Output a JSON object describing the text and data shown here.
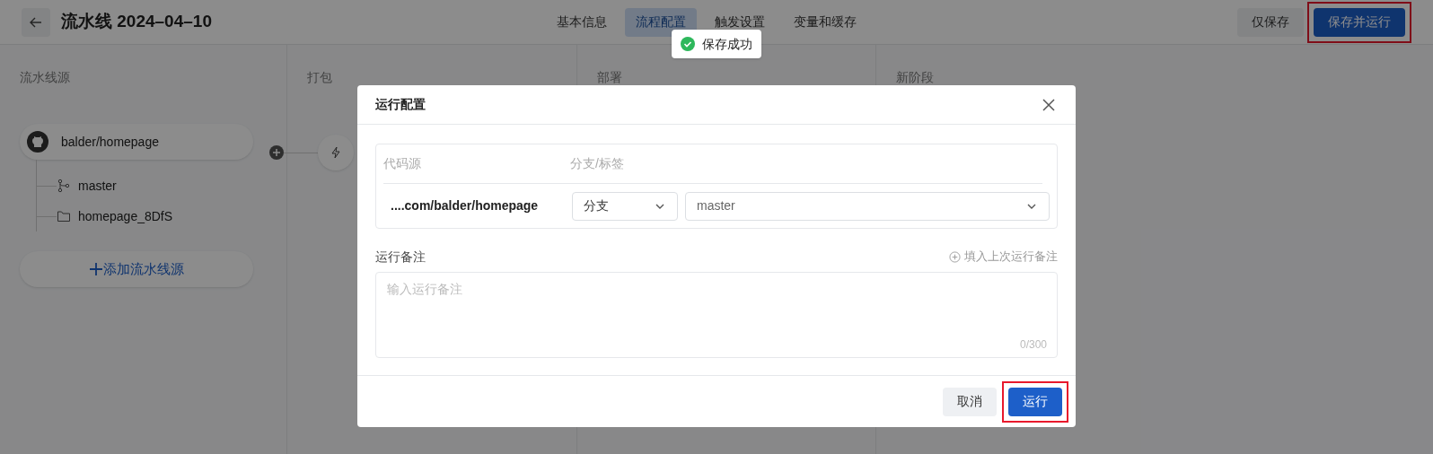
{
  "header": {
    "title": "流水线 2024–04–10",
    "tabs": [
      {
        "label": "基本信息",
        "selected": false
      },
      {
        "label": "流程配置",
        "selected": true
      },
      {
        "label": "触发设置",
        "selected": false
      },
      {
        "label": "变量和缓存",
        "selected": false
      }
    ],
    "actions": [
      {
        "label": "仅保存",
        "kind": "secondary",
        "highlighted": false
      },
      {
        "label": "保存并运行",
        "kind": "primary",
        "highlighted": true
      }
    ]
  },
  "toast": {
    "text": "保存成功"
  },
  "stages": [
    {
      "title": "流水线源"
    },
    {
      "title": "打包"
    },
    {
      "title": "部署"
    },
    {
      "title": "新阶段"
    }
  ],
  "source": {
    "repo": "balder/homepage",
    "children": [
      {
        "kind": "branch",
        "label": "master"
      },
      {
        "kind": "folder",
        "label": "homepage_8DfS"
      }
    ],
    "add_label": "添加流水线源"
  },
  "dialog": {
    "title": "运行配置",
    "columns": [
      "代码源",
      "分支/标签"
    ],
    "row": {
      "source": "....com/balder/homepage",
      "ref_type": "分支",
      "ref": "master"
    },
    "note_label": "运行备注",
    "fill_last": "填入上次运行备注",
    "note_placeholder": "输入运行备注",
    "counter": "0/300",
    "buttons": [
      {
        "label": "取消",
        "kind": "secondary",
        "highlighted": false
      },
      {
        "label": "运行",
        "kind": "primary",
        "highlighted": true
      }
    ]
  }
}
